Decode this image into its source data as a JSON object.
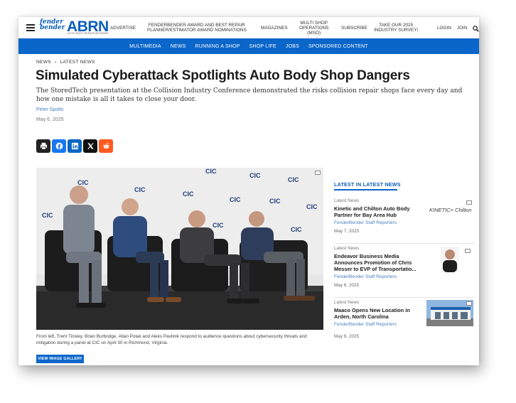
{
  "header": {
    "logo_fb": "fender bender",
    "logo_abrn": "ABRN",
    "logo_sub": "AUTO BODY REPAIR NETWORK",
    "nav": [
      {
        "label": "ADVERTISE"
      },
      {
        "label": "FENDERBENDER AWARD AND BEST REPAIR\nPLANNER/ESTIMATOR AWARD NOMINATIONS"
      },
      {
        "label": "MAGAZINES"
      },
      {
        "label": "MULTI SHOP\nOPERATIONS\n(MSO)"
      },
      {
        "label": "SUBSCRIBE"
      },
      {
        "label": "TAKE OUR 2025\nINDUSTRY SURVEY!"
      },
      {
        "label": "LOGIN"
      },
      {
        "label": "JOIN"
      }
    ]
  },
  "bluenav": [
    "MULTIMEDIA",
    "NEWS",
    "RUNNING A SHOP",
    "SHOP LIFE",
    "JOBS",
    "SPONSORED CONTENT"
  ],
  "breadcrumb": {
    "first": "NEWS",
    "sep": "›",
    "second": "LATEST NEWS"
  },
  "article": {
    "headline": "Simulated Cyberattack Spotlights Auto Body Shop Dangers",
    "dek": "The StoredTech presentation at the Collision Industry Conference demonstrated the risks collision repair shops face every day and how one mistake is all it takes to close your door.",
    "author": "Peter Spotts",
    "date": "May 6, 2025",
    "caption": "From left, Trent Tinsley, Brian Burbridge, Allan Polak and Aleks Pavlinik respond to audience questions about cybersecurity threats and mitigation during a panel at CIC on April 30 in Richmond, Virginia.",
    "gallery_button": "VIEW IMAGE GALLERY",
    "backdrop_logo": "CIC"
  },
  "share": [
    {
      "name": "print",
      "color": "#222222"
    },
    {
      "name": "facebook",
      "color": "#1877f2"
    },
    {
      "name": "linkedin",
      "color": "#0a66c2"
    },
    {
      "name": "x",
      "color": "#111111"
    },
    {
      "name": "reddit",
      "color": "#ff5a1f"
    }
  ],
  "sidebar": {
    "title": "LATEST IN LATEST NEWS",
    "items": [
      {
        "category": "Latest News",
        "title": "Kinetic and Chilton Auto Body Partner for Bay Area Hub",
        "byline": "FenderBender Staff Reporters",
        "date": "May 7, 2025",
        "thumb_text": "KINETIC> Chilton"
      },
      {
        "category": "Latest News",
        "title": "Endeavor Business Media Announces Promotion of Chris Messer to EVP of Transportatio...",
        "byline": "FenderBender Staff Reporters",
        "date": "May 6, 2025"
      },
      {
        "category": "Latest News",
        "title": "Maaco Opens New Location in Arden, North Carolina",
        "byline": "FenderBender Staff Reporters",
        "date": "May 6, 2025"
      }
    ]
  }
}
